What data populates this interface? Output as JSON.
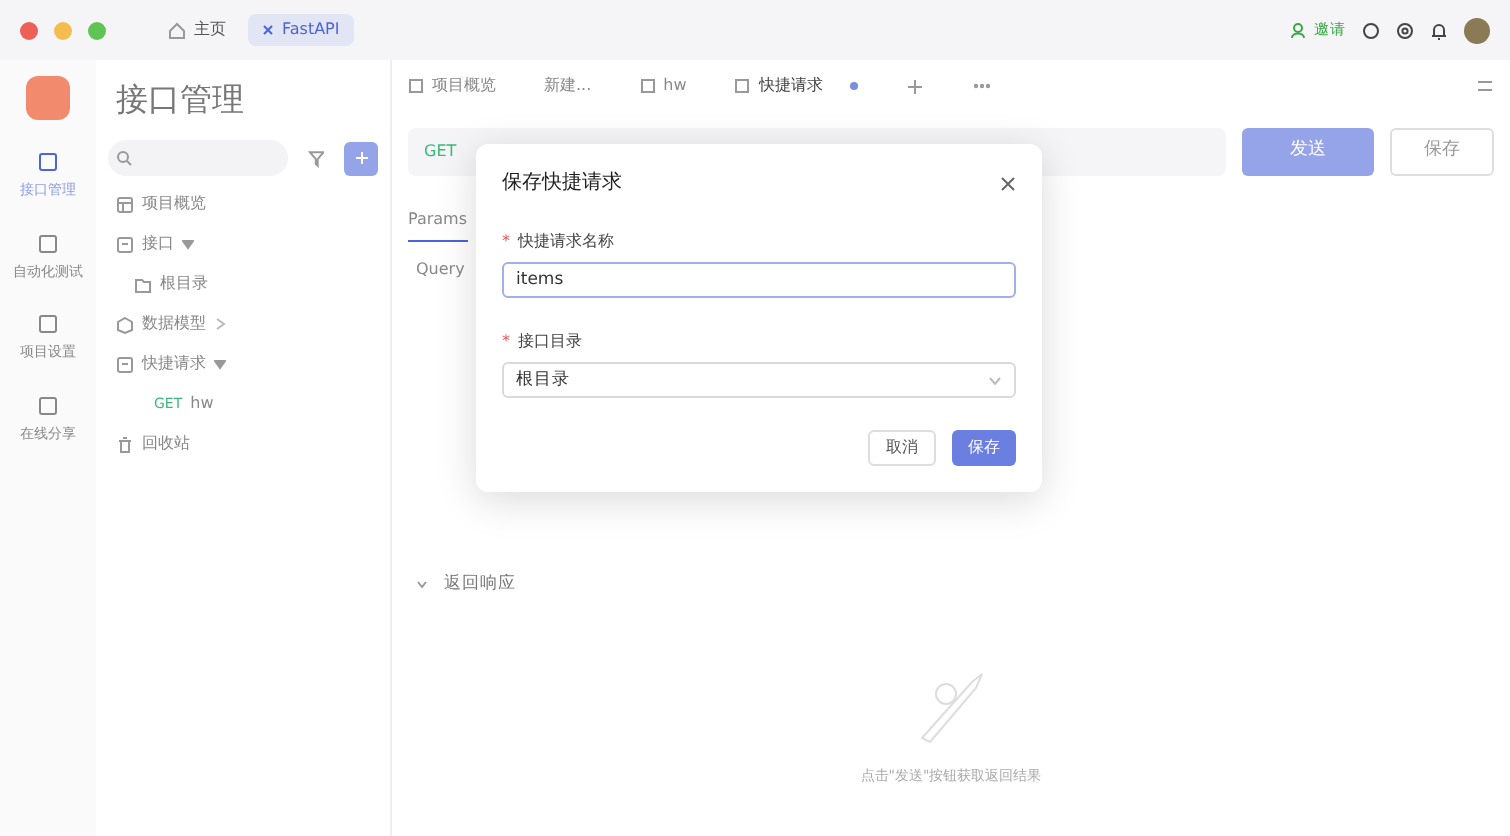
{
  "top_tabs": [
    {
      "label": "主页",
      "kind": "home",
      "selected": false
    },
    {
      "label": "FastAPI",
      "kind": "project",
      "selected": true
    }
  ],
  "top_actions": {
    "invite": "邀请"
  },
  "rail": [
    {
      "label": "接口管理",
      "selected": true
    },
    {
      "label": "自动化测试",
      "selected": false
    },
    {
      "label": "项目设置",
      "selected": false
    },
    {
      "label": "在线分享",
      "selected": false
    }
  ],
  "sidebar": {
    "title": "接口管理",
    "tree": [
      {
        "label": "项目概览",
        "kind": "overview"
      },
      {
        "label": "接口",
        "kind": "folder",
        "expanded": true,
        "children": [
          {
            "label": "根目录",
            "kind": "dir"
          }
        ]
      },
      {
        "label": "数据模型",
        "kind": "model",
        "expanded": false
      },
      {
        "label": "快捷请求",
        "kind": "folder",
        "expanded": true,
        "children": [
          {
            "label": "hw",
            "kind": "request",
            "method": "GET"
          }
        ]
      },
      {
        "label": "回收站",
        "kind": "trash"
      }
    ]
  },
  "main": {
    "tabs": [
      {
        "label": "项目概览",
        "kind": "overview",
        "selected": false,
        "unsaved": false
      },
      {
        "label": "新建...",
        "kind": "plain",
        "selected": false,
        "unsaved": false
      },
      {
        "label": "hw",
        "kind": "request",
        "selected": false,
        "unsaved": false
      },
      {
        "label": "快捷请求",
        "kind": "request",
        "selected": true,
        "unsaved": true
      }
    ],
    "method": "GET",
    "send": "发送",
    "save": "保存",
    "request_tabs": [
      {
        "label": "Params",
        "selected": true
      }
    ],
    "query_label": "Query",
    "response_title": "返回响应",
    "empty_hint": "点击\"发送\"按钮获取返回结果"
  },
  "dialog": {
    "title": "保存快捷请求",
    "fields": [
      {
        "label": "快捷请求名称",
        "required_mark": "*",
        "kind": "input",
        "value": "items"
      },
      {
        "label": "接口目录",
        "required_mark": "*",
        "kind": "select",
        "value": "根目录"
      }
    ],
    "buttons": [
      {
        "label": "取消",
        "primary": false
      },
      {
        "label": "保存",
        "primary": true
      }
    ]
  }
}
